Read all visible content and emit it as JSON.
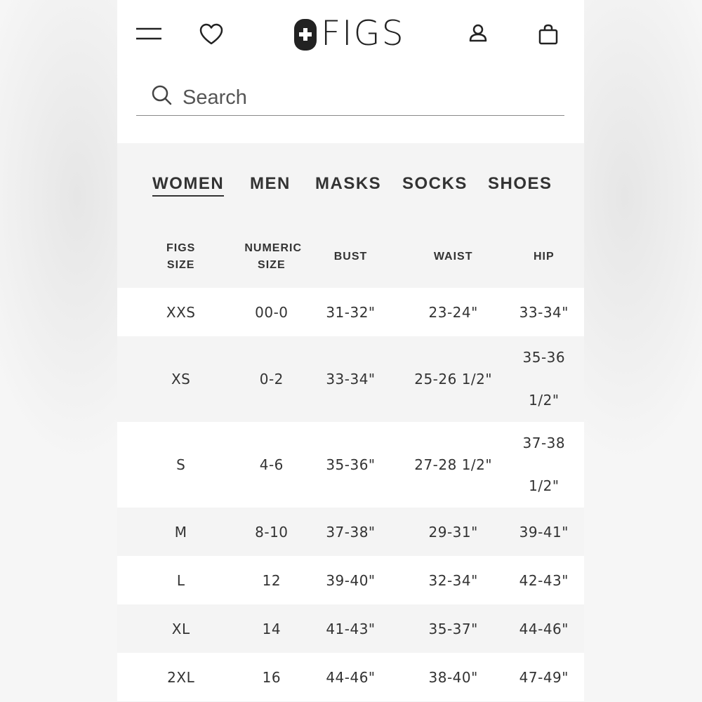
{
  "brand": {
    "name": "FIGS"
  },
  "search": {
    "placeholder": "Search"
  },
  "tabs": [
    {
      "label": "WOMEN",
      "active": true
    },
    {
      "label": "MEN",
      "active": false
    },
    {
      "label": "MASKS",
      "active": false
    },
    {
      "label": "SOCKS",
      "active": false
    },
    {
      "label": "SHOES",
      "active": false
    }
  ],
  "size_table": {
    "headers": {
      "figs_size_line1": "FIGS",
      "figs_size_line2": "SIZE",
      "numeric_size_line1": "NUMERIC",
      "numeric_size_line2": "SIZE",
      "bust": "BUST",
      "waist": "WAIST",
      "hip": "HIP"
    },
    "rows": [
      {
        "figs": "XXS",
        "numeric": "00-0",
        "bust": "31-32\"",
        "waist": "23-24\"",
        "hip": "33-34\""
      },
      {
        "figs": "XS",
        "numeric": "0-2",
        "bust": "33-34\"",
        "waist": "25-26 1/2\"",
        "hip_line1": "35-36",
        "hip_line2": "1/2\""
      },
      {
        "figs": "S",
        "numeric": "4-6",
        "bust": "35-36\"",
        "waist": "27-28 1/2\"",
        "hip_line1": "37-38",
        "hip_line2": "1/2\""
      },
      {
        "figs": "M",
        "numeric": "8-10",
        "bust": "37-38\"",
        "waist": "29-31\"",
        "hip": "39-41\""
      },
      {
        "figs": "L",
        "numeric": "12",
        "bust": "39-40\"",
        "waist": "32-34\"",
        "hip": "42-43\""
      },
      {
        "figs": "XL",
        "numeric": "14",
        "bust": "41-43\"",
        "waist": "35-37\"",
        "hip": "44-46\""
      },
      {
        "figs": "2XL",
        "numeric": "16",
        "bust": "44-46\"",
        "waist": "38-40\"",
        "hip": "47-49\""
      }
    ]
  },
  "icons": [
    "menu-icon",
    "heart-icon",
    "account-icon",
    "shopping-bag-icon",
    "search-icon",
    "figs-cross-logo-icon"
  ],
  "colors": {
    "text": "#333333",
    "background": "#f4f4f4",
    "header": "#ffffff"
  }
}
